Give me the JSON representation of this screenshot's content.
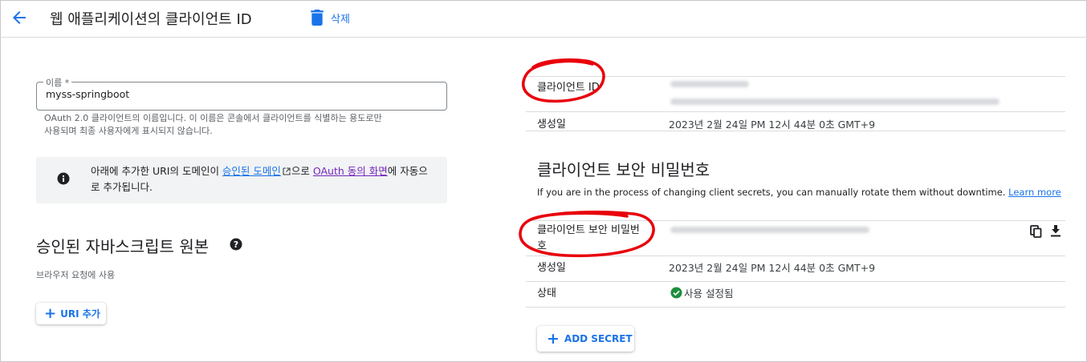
{
  "header": {
    "title": "웹 애플리케이션의 클라이언트 ID",
    "delete_label": "삭제"
  },
  "name_field": {
    "label": "이름 *",
    "value": "myss-springboot",
    "help_line1": "OAuth 2.0 클라이언트의 이름입니다. 이 이름은 콘솔에서 클라이언트를 식별하는 용도로만",
    "help_line2": "사용되며 최종 사용자에게 표시되지 않습니다."
  },
  "info": {
    "prefix": "아래에 추가한 URI의 도메인이 ",
    "link1": "승인된 도메인",
    "middle": "으로 ",
    "link2": "OAuth 동의 화면",
    "suffix": "에 자동으로 추가됩니다."
  },
  "origins": {
    "title": "승인된 자바스크립트 원본",
    "subtitle": "브라우저 요청에 사용",
    "add_uri_label": "URI 추가"
  },
  "client_info": {
    "client_id_label": "클라이언트 ID",
    "created_label": "생성일",
    "created_value": "2023년 2월 24일 PM 12시 44분 0초 GMT+9"
  },
  "secret_section": {
    "title": "클라이언트 보안 비밀번호",
    "description": "If you are in the process of changing client secrets, you can manually rotate them without downtime.",
    "learn_more": "Learn more",
    "secret_label_line1": "클라이언트 보안 비밀번",
    "secret_label_line2": "호",
    "created_label": "생성일",
    "created_value": "2023년 2월 24일 PM 12시 44분 0초 GMT+9",
    "status_label": "상태",
    "status_value": "사용 설정됨",
    "add_secret_label": "ADD SECRET"
  },
  "icons": {
    "back": "arrow-back-icon",
    "delete": "trash-icon",
    "info": "info-icon",
    "help": "help-icon",
    "plus": "plus-icon",
    "copy": "copy-icon",
    "download": "download-icon",
    "status": "check-circle-icon"
  },
  "colors": {
    "accent": "#1a73e8",
    "visited_link": "#7627bb",
    "success": "#1e8e3e",
    "annotation": "#e8000b"
  }
}
